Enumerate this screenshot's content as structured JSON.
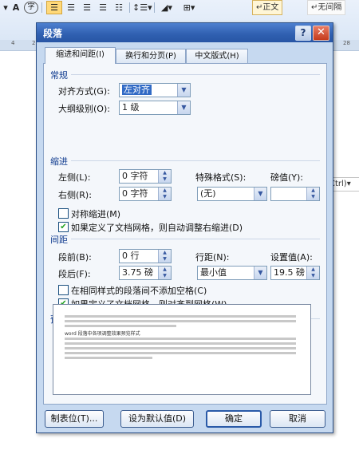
{
  "ribbon": {
    "style_normal": "↵正文",
    "style_nospacing": "↵无间隔"
  },
  "ruler_numbers": [
    "4",
    "2",
    "28"
  ],
  "background_doc": {
    "ctrl_tag": "Ctrl)▾"
  },
  "dialog": {
    "title": "段落",
    "help_glyph": "?",
    "close_glyph": "✕",
    "tabs": [
      {
        "label": "缩进和间距(I)",
        "active": true
      },
      {
        "label": "换行和分页(P)",
        "active": false
      },
      {
        "label": "中文版式(H)",
        "active": false
      }
    ],
    "general": {
      "heading": "常规",
      "alignment_label": "对齐方式(G):",
      "alignment_value": "左对齐",
      "outline_label": "大纲级别(O):",
      "outline_value": "1 级"
    },
    "indent": {
      "heading": "缩进",
      "left_label": "左侧(L):",
      "left_value": "0 字符",
      "right_label": "右侧(R):",
      "right_value": "0 字符",
      "special_label": "特殊格式(S):",
      "special_value": "(无)",
      "by_label": "磅值(Y):",
      "by_value": "",
      "mirror_label": "对称缩进(M)",
      "mirror_checked": false,
      "auto_adjust_label": "如果定义了文档网格，则自动调整右缩进(D)",
      "auto_adjust_checked": true
    },
    "spacing": {
      "heading": "间距",
      "before_label": "段前(B):",
      "before_value": "0 行",
      "after_label": "段后(F):",
      "after_value": "3.75 磅",
      "line_spacing_label": "行距(N):",
      "line_spacing_value": "最小值",
      "at_label": "设置值(A):",
      "at_value": "19.5 磅",
      "no_space_label": "在相同样式的段落间不添加空格(C)",
      "no_space_checked": false,
      "snap_grid_label": "如果定义了文档网格，则对齐到网格(W)",
      "snap_grid_checked": true
    },
    "preview": {
      "heading": "预览",
      "sample_text": "word 段落中各项调整效果预览样式"
    },
    "buttons": {
      "tabs": "制表位(T)...",
      "set_default": "设为默认值(D)",
      "ok": "确定",
      "cancel": "取消"
    }
  }
}
